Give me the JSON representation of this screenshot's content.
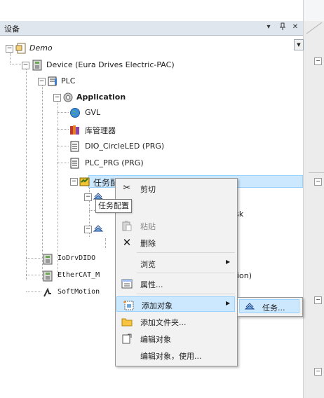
{
  "panel": {
    "title": "设备",
    "dropdown_label": "▾",
    "pin_label": "ᵖ",
    "close_label": "✕"
  },
  "tree": {
    "root": "Demo",
    "device": "Device (Eura Drives Electric-PAC)",
    "plc": "PLC",
    "application": "Application",
    "gvl": "GVL",
    "library": "库管理器",
    "dio": "DIO_CircleLED (PRG)",
    "plc_prg": "PLC_PRG (PRG)",
    "task_config": "任务配置",
    "task_partial": "_Task",
    "iodrv": "IoDrvDIDO",
    "ethercat": "EtherCAT_M",
    "ethercat_tail": "ion)",
    "softmotion": "SoftMotion"
  },
  "tooltip": "任务配置",
  "context_menu": {
    "cut": "剪切",
    "paste": "粘贴",
    "delete": "删除",
    "browse": "浏览",
    "properties": "属性...",
    "add_object": "添加对象",
    "add_folder": "添加文件夹...",
    "edit_object": "编辑对象",
    "edit_object_with": "编辑对象，使用..."
  },
  "submenu": {
    "task": "任务..."
  },
  "icons": {
    "cut": "scissors-icon",
    "paste": "paste-icon",
    "delete": "delete-x-icon",
    "properties": "properties-icon",
    "add_object": "add-object-icon",
    "add_folder": "folder-icon",
    "edit_object": "edit-object-icon",
    "task": "task-icon"
  }
}
